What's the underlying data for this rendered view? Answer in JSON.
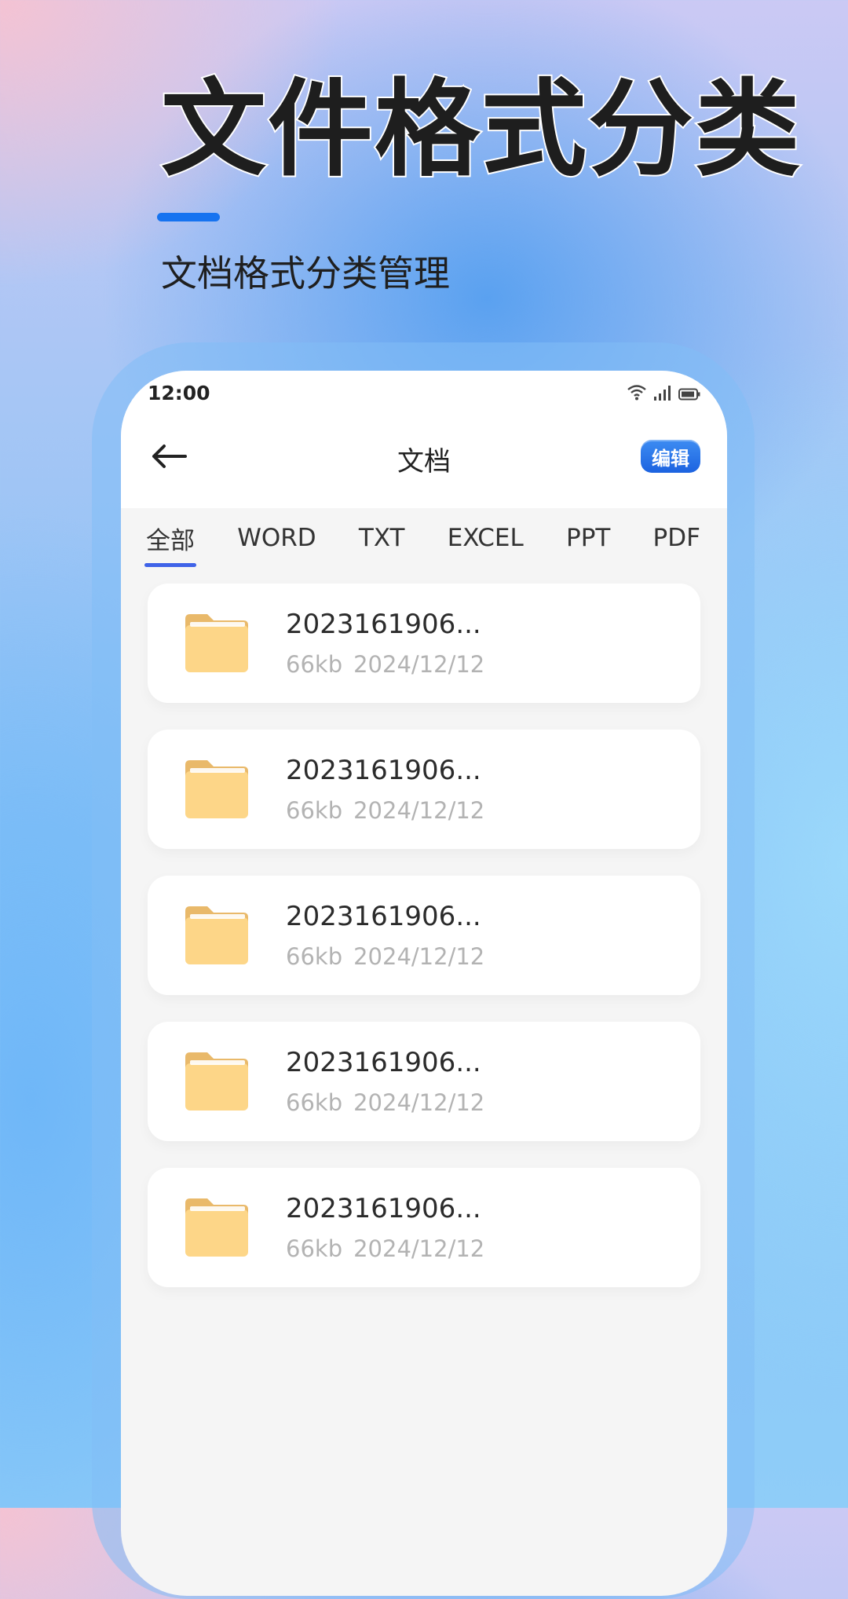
{
  "promo": {
    "headline": "文件格式分类",
    "subtitle": "文档格式分类管理",
    "accent_color": "#1673f0"
  },
  "status_bar": {
    "time": "12:00",
    "icons": [
      "wifi-icon",
      "signal-icon",
      "battery-icon"
    ]
  },
  "nav": {
    "back_icon": "arrow-left-icon",
    "title": "文档",
    "edit_label": "编辑"
  },
  "tabs": [
    {
      "label": "全部",
      "active": true
    },
    {
      "label": "WORD",
      "active": false
    },
    {
      "label": "TXT",
      "active": false
    },
    {
      "label": "EXCEL",
      "active": false
    },
    {
      "label": "PPT",
      "active": false
    },
    {
      "label": "PDF",
      "active": false
    }
  ],
  "files": [
    {
      "name": "2023161906...",
      "size": "66kb",
      "date": "2024/12/12",
      "icon": "folder-icon"
    },
    {
      "name": "2023161906...",
      "size": "66kb",
      "date": "2024/12/12",
      "icon": "folder-icon"
    },
    {
      "name": "2023161906...",
      "size": "66kb",
      "date": "2024/12/12",
      "icon": "folder-icon"
    },
    {
      "name": "2023161906...",
      "size": "66kb",
      "date": "2024/12/12",
      "icon": "folder-icon"
    },
    {
      "name": "2023161906...",
      "size": "66kb",
      "date": "2024/12/12",
      "icon": "folder-icon"
    }
  ],
  "colors": {
    "tab_indicator": "#3f63e8",
    "edit_button": "#1c63e0",
    "folder": "#fdd688"
  }
}
